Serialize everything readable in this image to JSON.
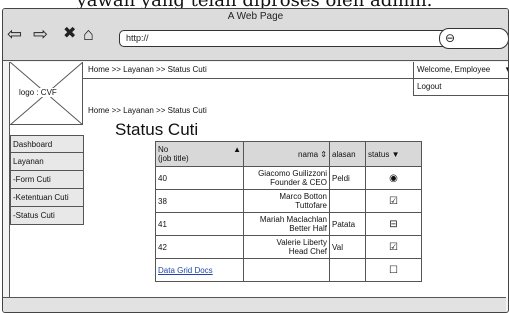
{
  "caption": "yawan yang telah diproses oleh admin.",
  "window": {
    "title": "A Web Page",
    "url": "http://"
  },
  "icons": {
    "back": "back-arrow-icon",
    "forward": "forward-arrow-icon",
    "close": "close-icon",
    "home": "home-icon",
    "search": "search-icon",
    "logo_placeholder": "logo-placeholder-image"
  },
  "header": {
    "logo_text": "logo : CVF",
    "breadcrumb": "Home >> Layanan >> Status Cuti",
    "welcome": "Welcome, Employee",
    "logout": "Logout"
  },
  "main": {
    "breadcrumb": "Home >> Layanan >> Status Cuti",
    "title": "Status Cuti"
  },
  "sidebar": {
    "items": [
      {
        "label": "Dashboard"
      },
      {
        "label": "Layanan"
      },
      {
        "label": "-Form Cuti"
      },
      {
        "label": "-Ketentuan Cuti"
      },
      {
        "label": "-Status Cuti"
      }
    ]
  },
  "grid": {
    "headers": {
      "no": "No\n(job title)",
      "nama": "nama",
      "alasan": "alasan",
      "status": "status"
    },
    "rows": [
      {
        "no": "40",
        "nama": "Giacomo Guilizzoni\nFounder & CEO",
        "alasan": "Peldi",
        "status": "radio"
      },
      {
        "no": "38",
        "nama": "Marco Botton\nTuttofare",
        "alasan": "",
        "status": "checked"
      },
      {
        "no": "41",
        "nama": "Mariah Maclachlan\nBetter Half",
        "alasan": "Patata",
        "status": "indeterminate"
      },
      {
        "no": "42",
        "nama": "Valerie Liberty\nHead Chef",
        "alasan": "Val",
        "status": "checked"
      }
    ],
    "footer_link": "Data Grid Docs",
    "status_glyphs": {
      "radio": "◉",
      "checked": "☑",
      "indeterminate": "⊟",
      "unchecked": "☐"
    }
  }
}
